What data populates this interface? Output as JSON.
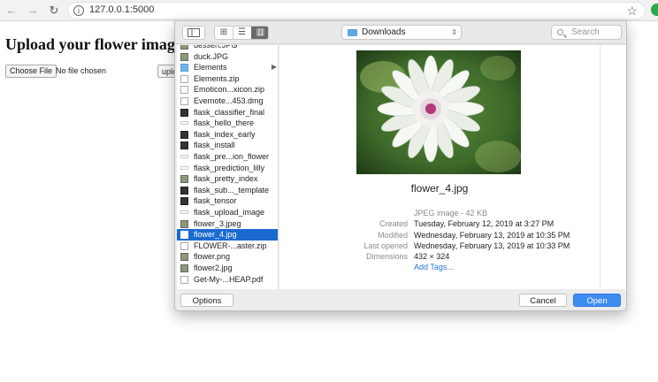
{
  "browser": {
    "url": "127.0.0.1:5000",
    "back_icon": "←",
    "forward_icon": "→",
    "reload_icon": "↻",
    "info_icon": "i",
    "star_icon": "☆"
  },
  "page": {
    "title": "Upload your flower image",
    "choose_file_label": "Choose File",
    "file_status": "No file chosen",
    "upload_label": "upload"
  },
  "dialog": {
    "location": "Downloads",
    "search_placeholder": "Search",
    "options_label": "Options",
    "cancel_label": "Cancel",
    "open_label": "Open",
    "files": [
      {
        "name": "dessert.JPG",
        "icon": "image-icon"
      },
      {
        "name": "duck.JPG",
        "icon": "image-icon"
      },
      {
        "name": "Elements",
        "icon": "folder-icon"
      },
      {
        "name": "Elements.zip",
        "icon": "zip-icon"
      },
      {
        "name": "Emoticon...xicon.zip",
        "icon": "zip-icon"
      },
      {
        "name": "Evernote...453.dmg",
        "icon": "zip-icon"
      },
      {
        "name": "flask_classifier_final",
        "icon": "dark-file-icon"
      },
      {
        "name": "flask_hello_there",
        "icon": "blank-file-icon"
      },
      {
        "name": "flask_index_early",
        "icon": "dark-file-icon"
      },
      {
        "name": "flask_install",
        "icon": "dark-file-icon"
      },
      {
        "name": "flask_pre...ion_flower",
        "icon": "blank-file-icon"
      },
      {
        "name": "flask_prediction_lilly",
        "icon": "blank-file-icon"
      },
      {
        "name": "flask_pretty_index",
        "icon": "image-icon"
      },
      {
        "name": "flask_sub..._template",
        "icon": "dark-file-icon"
      },
      {
        "name": "flask_tensor",
        "icon": "dark-file-icon"
      },
      {
        "name": "flask_upload_image",
        "icon": "blank-file-icon"
      },
      {
        "name": "flower_3.jpeg",
        "icon": "image-icon"
      },
      {
        "name": "flower_4.jpg",
        "icon": "image-icon",
        "selected": true
      },
      {
        "name": "FLOWER-...aster.zip",
        "icon": "zip-icon"
      },
      {
        "name": "flower.png",
        "icon": "image-icon"
      },
      {
        "name": "flower2.jpg",
        "icon": "image-icon"
      },
      {
        "name": "Get-My-...HEAP.pdf",
        "icon": "zip-icon"
      }
    ],
    "preview": {
      "filename": "flower_4.jpg",
      "kind": "JPEG image - 42 KB",
      "labels": [
        "Created",
        "Modified",
        "Last opened",
        "Dimensions"
      ],
      "values": [
        "Tuesday, February 12, 2019 at 3:27 PM",
        "Wednesday, February 13, 2019 at 10:35 PM",
        "Wednesday, February 13, 2019 at 10:33 PM",
        "432 × 324"
      ],
      "add_tags": "Add Tags..."
    }
  },
  "colors": {
    "selection": "#1b6ad0",
    "open_button": "#3d8cf0",
    "link": "#2a75d6"
  }
}
